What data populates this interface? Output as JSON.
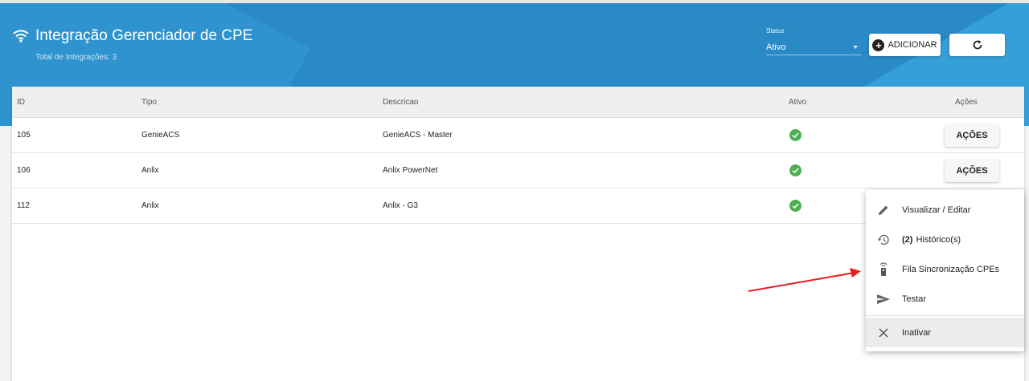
{
  "header": {
    "title": "Integração Gerenciador de CPE",
    "subtitle": "Total de Integrações: 3",
    "status_label": "Status",
    "status_value": "Ativo",
    "add_label": "ADICIONAR",
    "colors": {
      "header_bg": "#2a8ac6",
      "accent_green": "#4caf50"
    }
  },
  "table": {
    "columns": [
      "ID",
      "Tipo",
      "Descricao",
      "Ativo",
      "Ações"
    ],
    "rows": [
      {
        "id": "105",
        "tipo": "GenieACS",
        "descricao": "GenieACS - Master",
        "acoes": "AÇÕES"
      },
      {
        "id": "106",
        "tipo": "Anlix",
        "descricao": "Anlix PowerNet",
        "acoes": "AÇÕES"
      },
      {
        "id": "112",
        "tipo": "Anlix",
        "descricao": "Anlix - G3"
      }
    ]
  },
  "menu": {
    "items": [
      {
        "icon": "pencil-icon",
        "label": "Visualizar / Editar"
      },
      {
        "icon": "history-icon",
        "count": "(2)",
        "label": "Histórico(s)"
      },
      {
        "icon": "router-icon",
        "label": "Fila Sincronização CPEs"
      },
      {
        "icon": "send-icon",
        "label": "Testar"
      },
      {
        "icon": "close-icon",
        "label": "Inativar"
      }
    ]
  }
}
